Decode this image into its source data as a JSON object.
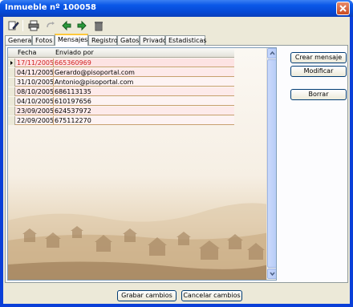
{
  "window": {
    "title": "Inmueble nº 100058"
  },
  "toolbar": {
    "buttons": [
      "edit-icon",
      "print-icon",
      "redo-icon",
      "back-arrow-icon",
      "forward-arrow-icon",
      "trash-icon"
    ]
  },
  "tabs": [
    {
      "label": "General"
    },
    {
      "label": "Fotos"
    },
    {
      "label": "Mensajes"
    },
    {
      "label": "Registro"
    },
    {
      "label": "Gatos"
    },
    {
      "label": "Privado"
    },
    {
      "label": "Estadisticas"
    }
  ],
  "active_tab": "Mensajes",
  "grid": {
    "columns": [
      "Fecha",
      "Enviado por"
    ],
    "rows": [
      {
        "fecha": "17/11/2005",
        "enviado": "665360969"
      },
      {
        "fecha": "04/11/2005",
        "enviado": "Gerardo@pisoportal.com"
      },
      {
        "fecha": "31/10/2005",
        "enviado": "Antonio@pisoportal.com"
      },
      {
        "fecha": "08/10/2005",
        "enviado": "686113135"
      },
      {
        "fecha": "04/10/2005",
        "enviado": "610197656"
      },
      {
        "fecha": "23/09/2005",
        "enviado": "624537972"
      },
      {
        "fecha": "22/09/2005",
        "enviado": "675112270"
      }
    ]
  },
  "actions": {
    "crear": "Crear mensaje",
    "modificar": "Modificar",
    "borrar": "Borrar"
  },
  "footer": {
    "grabar": "Grabar cambios",
    "cancelar": "Cancelar cambios"
  },
  "colors": {
    "titlebar": "#0549d6",
    "selected_row_text": "#d02020",
    "row_border": "#c8a070"
  }
}
